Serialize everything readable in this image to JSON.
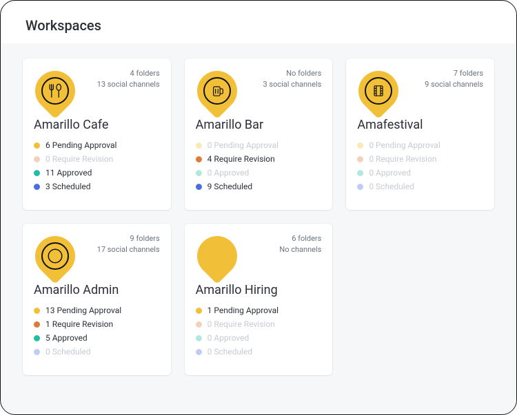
{
  "header": {
    "title": "Workspaces"
  },
  "colors": {
    "accent": "#f2c038",
    "pending": "#f2c038",
    "revision": "#e07a3a",
    "approved": "#1fbfa3",
    "scheduled": "#4a6ee0"
  },
  "workspaces": [
    {
      "icon": "fork-spoon",
      "folders_line": "4 folders",
      "channels_line": "13 social channels",
      "title": "Amarillo Cafe",
      "statuses": [
        {
          "label": "6 Pending Approval",
          "color": "pending",
          "muted": false
        },
        {
          "label": "0 Require Revision",
          "color": "revision",
          "muted": true
        },
        {
          "label": "11 Approved",
          "color": "approved",
          "muted": false
        },
        {
          "label": "3 Scheduled",
          "color": "scheduled",
          "muted": false
        }
      ]
    },
    {
      "icon": "beer-mug",
      "folders_line": "No folders",
      "channels_line": "3 social channels",
      "title": "Amarillo Bar",
      "statuses": [
        {
          "label": "0 Pending Approval",
          "color": "pending",
          "muted": true
        },
        {
          "label": "4 Require Revision",
          "color": "revision",
          "muted": false
        },
        {
          "label": "0 Approved",
          "color": "approved",
          "muted": true
        },
        {
          "label": "9 Scheduled",
          "color": "scheduled",
          "muted": false
        }
      ]
    },
    {
      "icon": "film-strip",
      "folders_line": "7 folders",
      "channels_line": "9 social channels",
      "title": "Amafestival",
      "statuses": [
        {
          "label": "0 Pending Approval",
          "color": "pending",
          "muted": true
        },
        {
          "label": "0 Require Revision",
          "color": "revision",
          "muted": true
        },
        {
          "label": "0 Approved",
          "color": "approved",
          "muted": true
        },
        {
          "label": "0 Scheduled",
          "color": "scheduled",
          "muted": true
        }
      ]
    },
    {
      "icon": "plate",
      "folders_line": "9 folders",
      "channels_line": "17 social channels",
      "title": "Amarillo Admin",
      "statuses": [
        {
          "label": "13 Pending Approval",
          "color": "pending",
          "muted": false
        },
        {
          "label": "1 Require Revision",
          "color": "revision",
          "muted": false
        },
        {
          "label": "5 Approved",
          "color": "approved",
          "muted": false
        },
        {
          "label": "0 Scheduled",
          "color": "scheduled",
          "muted": true
        }
      ]
    },
    {
      "icon": "blank",
      "folders_line": "6 folders",
      "channels_line": "No channels",
      "title": "Amarillo Hiring",
      "statuses": [
        {
          "label": "1 Pending Approval",
          "color": "pending",
          "muted": false
        },
        {
          "label": "0 Require Revision",
          "color": "revision",
          "muted": true
        },
        {
          "label": "0 Approved",
          "color": "approved",
          "muted": true
        },
        {
          "label": "0 Scheduled",
          "color": "scheduled",
          "muted": true
        }
      ]
    }
  ]
}
